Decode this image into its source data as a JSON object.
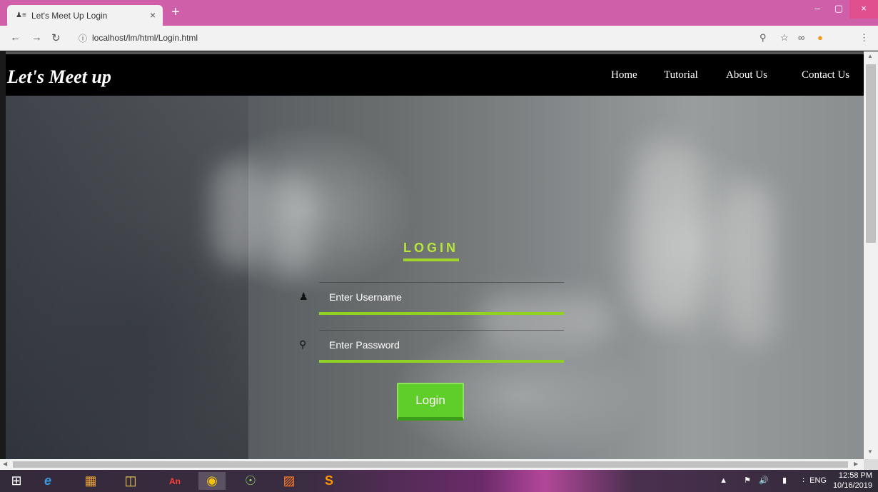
{
  "browser": {
    "tab_title": "Let's Meet Up Login",
    "tab_close": "×",
    "new_tab": "+",
    "url": "localhost/lm/html/Login.html",
    "window_controls": {
      "minimize": "–",
      "maximize": "▢",
      "close": "×"
    }
  },
  "site": {
    "brand": "Let's Meet up",
    "nav": [
      "Home",
      "Tutorial",
      "About Us",
      "Contact Us"
    ]
  },
  "login": {
    "title": "LOGIN",
    "username_placeholder": "Enter Username",
    "password_placeholder": "Enter Password",
    "button_label": "Login",
    "accent_color": "#8fd224",
    "button_color": "#5fce2a"
  },
  "taskbar": {
    "apps": [
      "start-icon",
      "ie-icon",
      "winrar-icon",
      "file-explorer-icon",
      "animate-icon",
      "chrome-icon",
      "android-studio-icon",
      "xampp-icon",
      "sublime-icon"
    ],
    "language": "ENG",
    "time": "12:58 PM",
    "date": "10/16/2019"
  }
}
